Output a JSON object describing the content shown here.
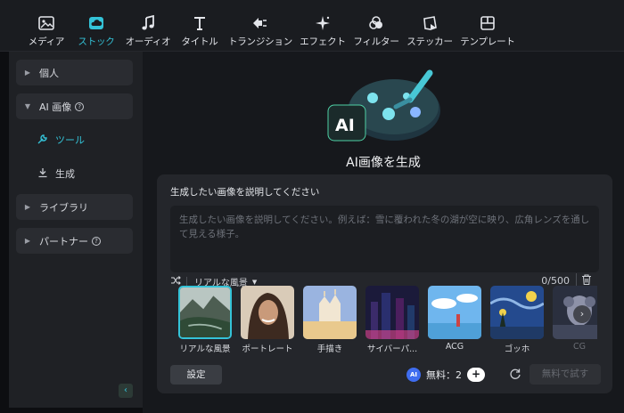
{
  "toolbar": {
    "tabs": [
      {
        "label": "メディア",
        "icon": "media-icon",
        "active": false
      },
      {
        "label": "ストック",
        "icon": "stock-cloud-icon",
        "active": true
      },
      {
        "label": "オーディオ",
        "icon": "music-note-icon",
        "active": false
      },
      {
        "label": "タイトル",
        "icon": "title-t-icon",
        "active": false
      },
      {
        "label": "トランジション",
        "icon": "transition-icon",
        "active": false
      },
      {
        "label": "エフェクト",
        "icon": "effect-sparkle-icon",
        "active": false
      },
      {
        "label": "フィルター",
        "icon": "filter-icon",
        "active": false
      },
      {
        "label": "ステッカー",
        "icon": "sticker-icon",
        "active": false
      },
      {
        "label": "テンプレート",
        "icon": "template-icon",
        "active": false
      }
    ],
    "accent_color": "#34c3d8"
  },
  "sidebar": {
    "items": [
      {
        "label": "個人",
        "expanded": false
      },
      {
        "label": "AI 画像",
        "expanded": true,
        "help": "?"
      },
      {
        "label": "ライブラリ",
        "expanded": false
      },
      {
        "label": "パートナー",
        "expanded": false,
        "help": "?"
      }
    ],
    "sub_items": [
      {
        "label": "ツール",
        "icon": "wrench-icon",
        "active": true
      },
      {
        "label": "生成",
        "icon": "download-icon",
        "active": false
      }
    ],
    "collapse_glyph": "‹"
  },
  "main": {
    "hero_title": "AI画像を生成",
    "hero_logo_text": "AI",
    "panel": {
      "title": "生成したい画像を説明してください",
      "placeholder": "生成したい画像を説明してください。例えば：雪に覆われた冬の湖が空に映り、広角レンズを通して見える様子。",
      "style_selected": "リアルな風景",
      "counter": "0/500",
      "styles": [
        {
          "label": "リアルな風景",
          "selected": true
        },
        {
          "label": "ポートレート",
          "selected": false
        },
        {
          "label": "手描き",
          "selected": false
        },
        {
          "label": "サイバーパ...",
          "selected": false
        },
        {
          "label": "ACG",
          "selected": false
        },
        {
          "label": "ゴッホ",
          "selected": false
        },
        {
          "label": "CG",
          "selected": false
        }
      ],
      "next_glyph": "›",
      "settings_label": "設定",
      "ai_badge": "AI",
      "credits_label": "無料：2",
      "plus_label": "+",
      "try_label": "無料で試す"
    }
  }
}
